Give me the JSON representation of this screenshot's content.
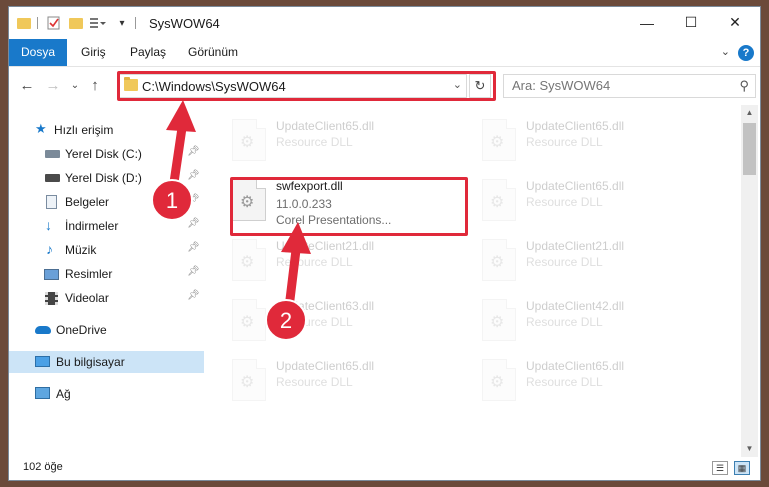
{
  "window": {
    "title": "SysWOW64"
  },
  "ribbon": {
    "tabs": [
      "Dosya",
      "Giriş",
      "Paylaş",
      "Görünüm"
    ],
    "help": "?"
  },
  "address": {
    "path": "C:\\Windows\\SysWOW64"
  },
  "search": {
    "placeholder": "Ara: SysWOW64"
  },
  "sidebar": {
    "items": [
      {
        "label": "Hızlı erişim"
      },
      {
        "label": "Yerel Disk (C:)"
      },
      {
        "label": "Yerel Disk (D:)"
      },
      {
        "label": "Belgeler"
      },
      {
        "label": "İndirmeler"
      },
      {
        "label": "Müzik"
      },
      {
        "label": "Resimler"
      },
      {
        "label": "Videolar"
      },
      {
        "label": "OneDrive"
      },
      {
        "label": "Bu bilgisayar"
      },
      {
        "label": "Ağ"
      }
    ]
  },
  "files": {
    "selected": {
      "name": "swfexport.dll",
      "version": "11.0.0.233",
      "company": "Corel Presentations..."
    },
    "background": [
      {
        "name": "UpdateClient65.dll",
        "type": "Resource DLL"
      },
      {
        "name": "UpdateClient65.dll",
        "type": "Resource DLL"
      },
      {
        "name": "UpdateClient65.dll",
        "type": "Resource DLL"
      },
      {
        "name": "UpdateClient21.dll",
        "type": "Resource DLL"
      },
      {
        "name": "UpdateClient21.dll",
        "type": "Resource DLL"
      },
      {
        "name": "UpdateClient63.dll",
        "type": "Resource DLL"
      },
      {
        "name": "UpdateClient42.dll",
        "type": "Resource DLL"
      },
      {
        "name": "UpdateClient65.dll",
        "type": "Resource DLL"
      },
      {
        "name": "UpdateClient65.dll",
        "type": "Resource DLL"
      }
    ]
  },
  "status": {
    "count": "102 öğe"
  },
  "callouts": {
    "step1": "1",
    "step2": "2"
  },
  "colors": {
    "accent": "#1979ca",
    "highlight": "#e0293a",
    "selection": "#cce4f7"
  }
}
